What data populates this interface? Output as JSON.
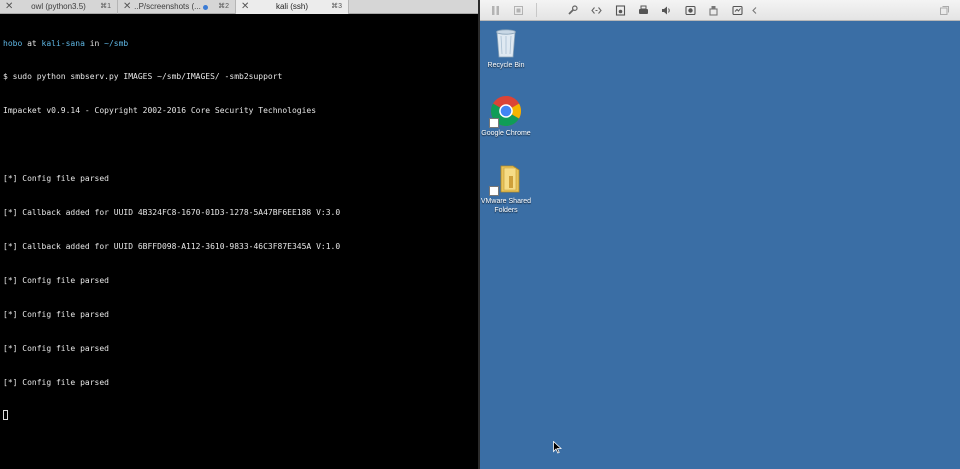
{
  "terminal": {
    "tabs": [
      {
        "title": "owl (python3.5)",
        "shortcut": "⌘1",
        "active": false
      },
      {
        "title": "..P/screenshots (...",
        "shortcut": "⌘2",
        "active": false
      },
      {
        "title": "kali (ssh)",
        "shortcut": "⌘3",
        "active": true
      }
    ],
    "prompt": {
      "user": "hobo",
      "at": " at ",
      "host": "kali-sana",
      "in": " in ",
      "dir": "~/smb"
    },
    "lines": [
      "$ sudo python smbserv.py IMAGES ~/smb/IMAGES/ -smb2support",
      "Impacket v0.9.14 - Copyright 2002-2016 Core Security Technologies",
      "",
      "[*] Config file parsed",
      "[*] Callback added for UUID 4B324FC8-1670-01D3-1278-5A47BF6EE188 V:3.0",
      "[*] Callback added for UUID 6BFFD098-A112-3610-9833-46C3F87E345A V:1.0",
      "[*] Config file parsed",
      "[*] Config file parsed",
      "[*] Config file parsed",
      "[*] Config file parsed"
    ]
  },
  "vm": {
    "toolbar_icons": [
      "pause-icon",
      "snapshot-icon",
      "wrench-icon",
      "code-icon",
      "disk-icon",
      "printer-icon",
      "speaker-icon",
      "camera-icon",
      "usb-icon",
      "network-icon",
      "collapse-arrow-icon",
      "window-icon"
    ],
    "desktop_icons": [
      {
        "name": "recycle-bin",
        "label": "Recycle Bin"
      },
      {
        "name": "google-chrome",
        "label": "Google Chrome"
      },
      {
        "name": "vmware-shared-folders",
        "label": "VMware Shared\nFolders"
      }
    ],
    "desktop_color": "#3a6ea5"
  },
  "colors": {
    "prompt_cyan": "#5fb7e5",
    "terminal_bg": "#000000",
    "terminal_fg": "#e6e6e6"
  }
}
